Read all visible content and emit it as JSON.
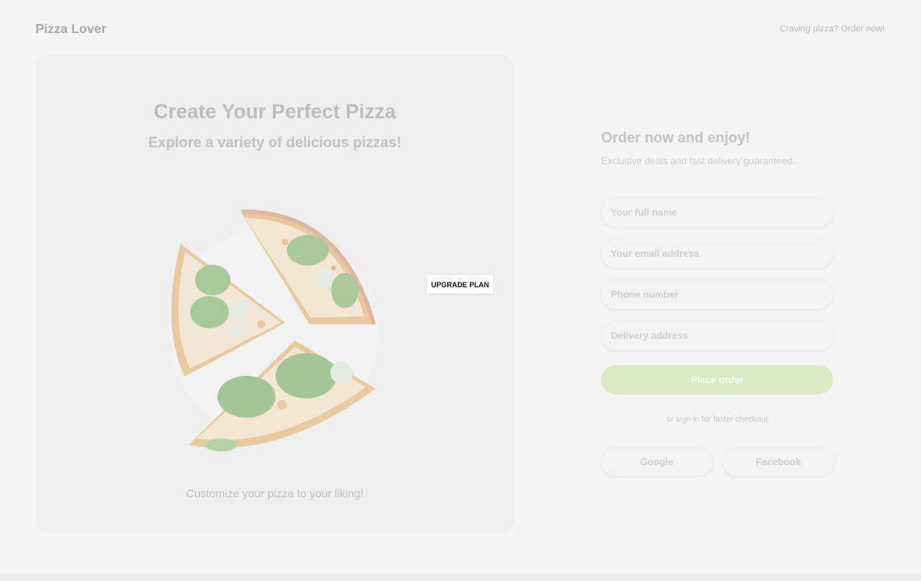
{
  "header": {
    "brand": "Pizza Lover",
    "cta_link": "Craving pizza? Order now!"
  },
  "hero": {
    "title": "Create Your Perfect Pizza",
    "subtitle": "Explore a variety of delicious pizzas!",
    "caption": "Customize your pizza to your liking!",
    "image_icon": "pizza-slices-illustration"
  },
  "overlay": {
    "upgrade_label": "UPGRADE PLAN"
  },
  "order": {
    "heading": "Order now and enjoy!",
    "subheading": "Exclusive deals and fast delivery guaranteed.",
    "fields": {
      "name_placeholder": "Your full name",
      "email_placeholder": "Your email address",
      "phone_placeholder": "Phone number",
      "address_placeholder": "Delivery address"
    },
    "submit_label": "Place order",
    "signin_note": "or sign in for faster checkout",
    "social": {
      "google_label": "Google",
      "facebook_label": "Facebook"
    }
  },
  "colors": {
    "accent": "#dbe9c5",
    "background": "#f4f4f4",
    "card": "#efefef"
  }
}
